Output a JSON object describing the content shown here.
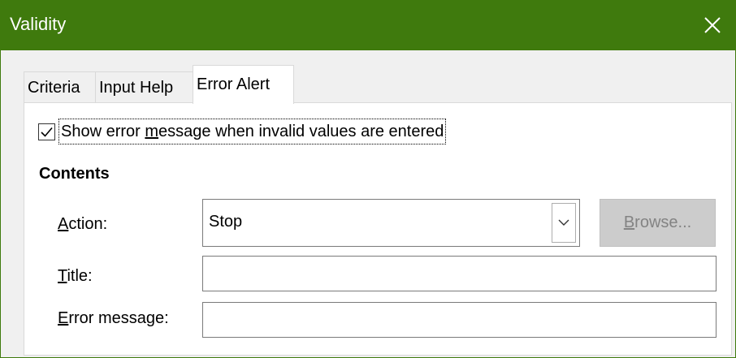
{
  "window": {
    "title": "Validity",
    "close_icon": "close-icon",
    "title_bar_color": "#3f7a0d"
  },
  "tabs": [
    {
      "label": "Criteria",
      "active": false
    },
    {
      "label": "Input Help",
      "active": false
    },
    {
      "label": "Error Alert",
      "active": true
    }
  ],
  "error_alert": {
    "show_error": {
      "checked": true,
      "label_before": "Show error ",
      "label_accel": "m",
      "label_after": "essage when invalid values are entered"
    },
    "contents_heading": "Contents",
    "action": {
      "label_accel": "A",
      "label_rest": "ction:",
      "value": "Stop"
    },
    "browse": {
      "label_accel": "B",
      "label_rest": "rowse...",
      "enabled": false
    },
    "title_field": {
      "label_accel": "T",
      "label_rest": "itle:",
      "value": ""
    },
    "error_message_field": {
      "label_accel": "E",
      "label_rest": "rror message:",
      "value": ""
    }
  }
}
